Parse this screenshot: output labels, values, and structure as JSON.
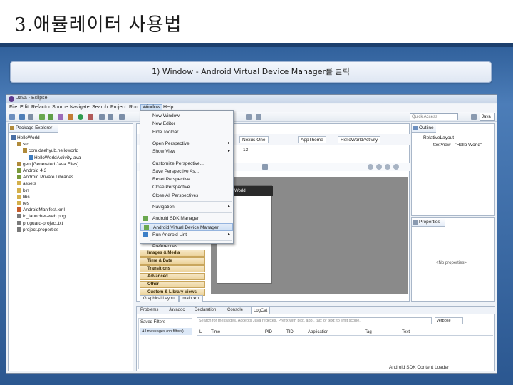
{
  "slide": {
    "title": "3.애뮬레이터 사용법",
    "caption": "1) Window - Android Virtual Device Manager를 클릭"
  },
  "window": {
    "title": "Java - Eclipse",
    "menubar": [
      "File",
      "Edit",
      "Refactor",
      "Source",
      "Navigate",
      "Search",
      "Project",
      "Run",
      "Window",
      "Help"
    ],
    "active_menu": "Window",
    "quick_access_placeholder": "Quick Access",
    "perspective": "Java"
  },
  "package_explorer": {
    "tab_label": "Package Explorer",
    "items": [
      {
        "label": "HelloWorld",
        "indent": 0,
        "color": "#4a6fa5"
      },
      {
        "label": "src",
        "indent": 1,
        "color": "#b08a3a"
      },
      {
        "label": "com.daehyub.helloworld",
        "indent": 2,
        "color": "#b08a3a"
      },
      {
        "label": "HelloWorldActivity.java",
        "indent": 3,
        "color": "#3b7bbf"
      },
      {
        "label": "gen [Generated Java Files]",
        "indent": 1,
        "color": "#b08a3a"
      },
      {
        "label": "Android 4.3",
        "indent": 1,
        "color": "#7a9a3a"
      },
      {
        "label": "Android Private Libraries",
        "indent": 1,
        "color": "#7a9a3a"
      },
      {
        "label": "assets",
        "indent": 1,
        "color": "#d4b04a"
      },
      {
        "label": "bin",
        "indent": 1,
        "color": "#d4b04a"
      },
      {
        "label": "libs",
        "indent": 1,
        "color": "#d4b04a"
      },
      {
        "label": "res",
        "indent": 1,
        "color": "#d4b04a"
      },
      {
        "label": "AndroidManifest.xml",
        "indent": 1,
        "color": "#c65b2a"
      },
      {
        "label": "ic_launcher-web.png",
        "indent": 1,
        "color": "#7a7a7a"
      },
      {
        "label": "proguard-project.txt",
        "indent": 1,
        "color": "#7a7a7a"
      },
      {
        "label": "project.properties",
        "indent": 1,
        "color": "#7a7a7a"
      }
    ]
  },
  "window_menu": {
    "items": [
      {
        "label": "New Window",
        "type": "item"
      },
      {
        "label": "New Editor",
        "type": "item"
      },
      {
        "label": "Hide Toolbar",
        "type": "item"
      },
      {
        "type": "sep"
      },
      {
        "label": "Open Perspective",
        "type": "submenu"
      },
      {
        "label": "Show View",
        "type": "submenu"
      },
      {
        "type": "sep"
      },
      {
        "label": "Customize Perspective...",
        "type": "item"
      },
      {
        "label": "Save Perspective As...",
        "type": "item"
      },
      {
        "label": "Reset Perspective...",
        "type": "item"
      },
      {
        "label": "Close Perspective",
        "type": "item"
      },
      {
        "label": "Close All Perspectives",
        "type": "item"
      },
      {
        "type": "sep"
      },
      {
        "label": "Navigation",
        "type": "submenu"
      },
      {
        "type": "sep"
      },
      {
        "label": "Android SDK Manager",
        "type": "item",
        "icon": "android-sdk-icon"
      },
      {
        "label": "Android Virtual Device Manager",
        "type": "item",
        "icon": "android-avd-icon",
        "highlighted": true
      },
      {
        "label": "Run Android Lint",
        "type": "submenu",
        "icon": "lint-check-icon"
      },
      {
        "type": "sep"
      },
      {
        "label": "Preferences",
        "type": "item"
      }
    ]
  },
  "editor": {
    "combo_device": "Nexus One",
    "combo_theme": "AppTheme",
    "combo_activity": "HelloWorldActivity",
    "api_level": "13",
    "device_text": "World",
    "palette": [
      "Images & Media",
      "Time & Date",
      "Transitions",
      "Advanced",
      "Other",
      "Custom & Library Views"
    ],
    "bottom_tabs": [
      "Graphical Layout",
      "main.xml"
    ]
  },
  "outline": {
    "tab_label": "Outline",
    "items": [
      "RelativeLayout",
      "textView - \"Hello World\""
    ]
  },
  "properties": {
    "tab_label": "Properties",
    "empty_text": "<No properties>"
  },
  "logcat": {
    "tabs": [
      "Problems",
      "Javadoc",
      "Declaration",
      "Console",
      "LogCat"
    ],
    "active_tab": "LogCat",
    "saved_filters": "Saved Filters",
    "all_messages": "All messages (no filters)",
    "search_placeholder": "Search for messages. Accepts Java regexes. Prefix with pid:, app:, tag: or text: to limit scope.",
    "level": "verbose",
    "columns": [
      "L",
      "Time",
      "PID",
      "TID",
      "Application",
      "Tag",
      "Text"
    ]
  },
  "status": "Android SDK Content Loader"
}
